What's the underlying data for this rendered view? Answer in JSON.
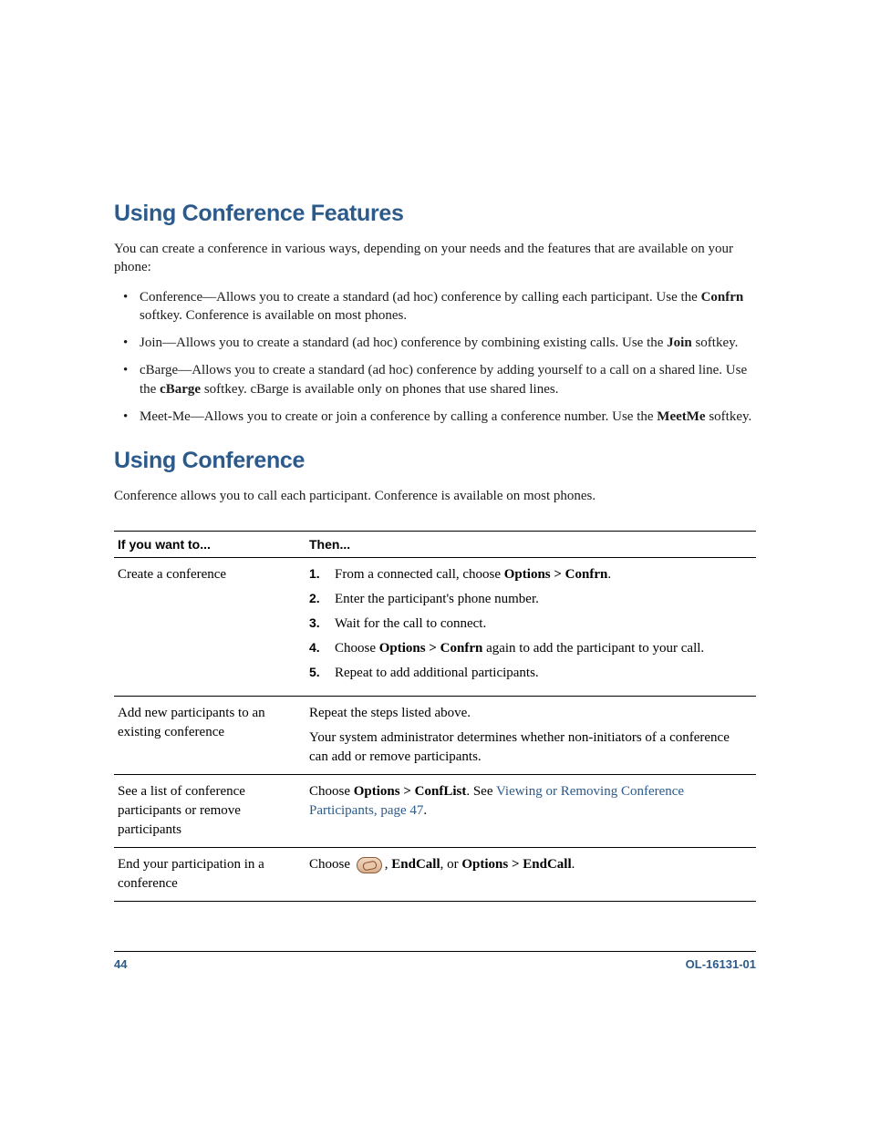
{
  "headings": {
    "h1": "Using Conference Features",
    "h2": "Using Conference"
  },
  "intro": "You can create a conference in various ways, depending on your needs and the features that are available on your phone:",
  "bullets": [
    {
      "pre": "Conference—Allows you to create a standard (ad hoc) conference by calling each participant. Use the ",
      "bold": "Confrn",
      "post": " softkey. Conference is available on most phones."
    },
    {
      "pre": "Join—Allows you to create a standard (ad hoc) conference by combining existing calls. Use the ",
      "bold": "Join",
      "post": " softkey."
    },
    {
      "pre": "cBarge—Allows you to create a standard (ad hoc) conference by adding yourself to a call on a shared line. Use the ",
      "bold": "cBarge",
      "post": " softkey. cBarge is available only on phones that use shared lines."
    },
    {
      "pre": "Meet-Me—Allows you to create or join a conference by calling a conference number. Use the ",
      "bold": "MeetMe",
      "post": " softkey."
    }
  ],
  "conf_intro": "Conference allows you to call each participant. Conference is available on most phones.",
  "table": {
    "th1": "If you want to...",
    "th2": "Then...",
    "rows": [
      {
        "col1": "Create a conference",
        "steps": [
          {
            "pre": "From a connected call, choose ",
            "bold": "Options > Confrn",
            "post": "."
          },
          {
            "pre": "Enter the participant's phone number.",
            "bold": "",
            "post": ""
          },
          {
            "pre": "Wait for the call to connect.",
            "bold": "",
            "post": ""
          },
          {
            "pre": "Choose ",
            "bold": "Options > Confrn",
            "post": " again to add the participant to your call."
          },
          {
            "pre": "Repeat to add additional participants.",
            "bold": "",
            "post": ""
          }
        ]
      },
      {
        "col1": "Add new participants to an existing conference",
        "para1": "Repeat the steps listed above.",
        "para2": "Your system administrator determines whether non-initiators of a conference can add or remove participants."
      },
      {
        "col1": "See a list of conference participants or remove participants",
        "pre": "Choose ",
        "bold": "Options > ConfList",
        "mid": ". See ",
        "link": "Viewing or Removing Conference Participants, page 47",
        "post": "."
      },
      {
        "col1": "End your participation in a conference",
        "pre": "Choose ",
        "mid1": ", ",
        "bold1": "EndCall",
        "mid2": ", or ",
        "bold2": "Options > EndCall",
        "post": "."
      }
    ]
  },
  "footer": {
    "page": "44",
    "docid": "OL-16131-01"
  }
}
